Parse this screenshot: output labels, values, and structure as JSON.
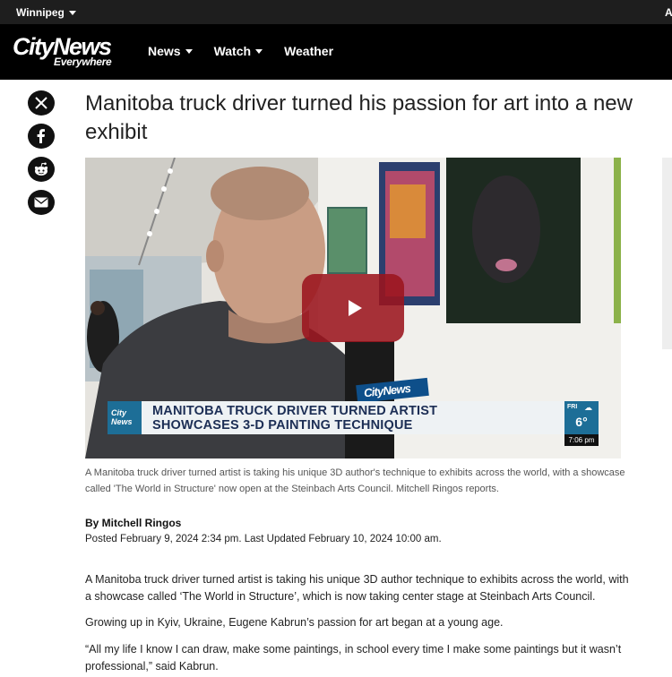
{
  "location_bar": {
    "city": "Winnipeg",
    "right_initial": "A"
  },
  "header": {
    "logo_main": "CityNews",
    "logo_sub": "Everywhere",
    "nav": [
      {
        "label": "News",
        "has_dropdown": true
      },
      {
        "label": "Watch",
        "has_dropdown": true
      },
      {
        "label": "Weather",
        "has_dropdown": false
      }
    ]
  },
  "share_icons": [
    "x-icon",
    "facebook-icon",
    "reddit-icon",
    "email-icon"
  ],
  "article": {
    "title": "Manitoba truck driver turned his passion for art into a new exhibit",
    "video": {
      "chyron_badge_line1": "City",
      "chyron_badge_line2": "News",
      "chyron_line1": "MANITOBA TRUCK DRIVER TURNED ARTIST",
      "chyron_line2": "SHOWCASES 3-D PAINTING TECHNIQUE",
      "weather_day": "FRI",
      "weather_temp": "6°",
      "time": "7:06 pm",
      "mic_flag": "CityNews"
    },
    "caption": "A Manitoba truck driver turned artist is taking his unique 3D author's technique to exhibits across the world, with a showcase called 'The World in Structure' now open at the Steinbach Arts Council. Mitchell Ringos reports.",
    "byline": "By Mitchell Ringos",
    "dates": "Posted February 9, 2024 2:34 pm.  Last Updated February 10, 2024 10:00 am.",
    "paragraphs": [
      "A Manitoba truck driver turned artist is taking his unique 3D author technique to exhibits across the world, with a showcase called ‘The World in Structure’, which is now taking center stage at Steinbach Arts Council.",
      "Growing up in Kyiv, Ukraine, Eugene Kabrun’s passion for art began at a young age.",
      "“All my life I know I can draw, make some paintings, in school every time I make some paintings but it wasn’t professional,” said Kabrun."
    ]
  },
  "colors": {
    "topbar": "#1e1e1e",
    "header": "#000000",
    "play_button": "#9b141e",
    "chyron_blue": "#1d6e97",
    "chyron_text": "#1c2e55"
  }
}
